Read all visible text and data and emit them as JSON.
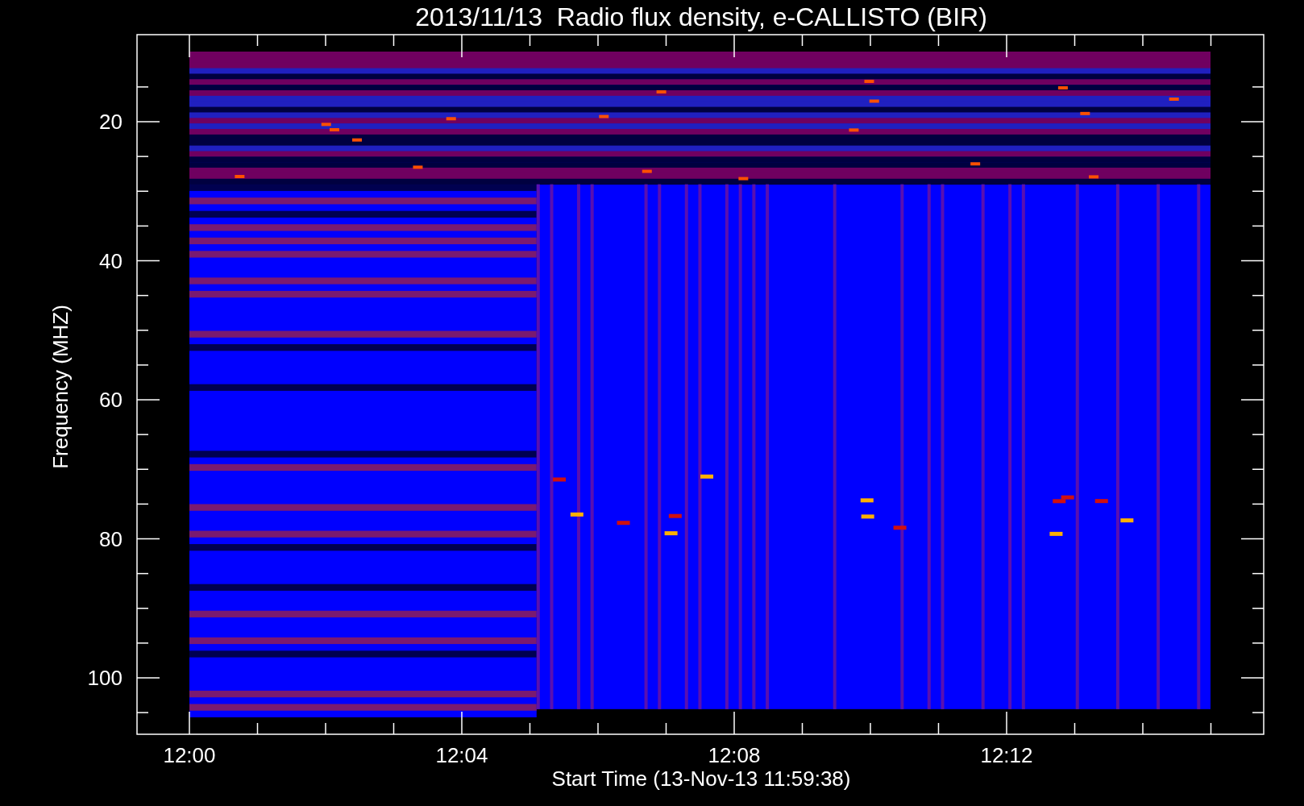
{
  "title": "2013/11/13  Radio flux density, e-CALLISTO (BIR)",
  "y_axis": {
    "label": "Frequency (MHZ)",
    "ticks": [
      "20",
      "40",
      "60",
      "80",
      "100"
    ]
  },
  "x_axis": {
    "label": "Start Time (13-Nov-13 11:59:38)",
    "ticks": [
      "12:00",
      "12:04",
      "12:08",
      "12:12"
    ]
  }
}
